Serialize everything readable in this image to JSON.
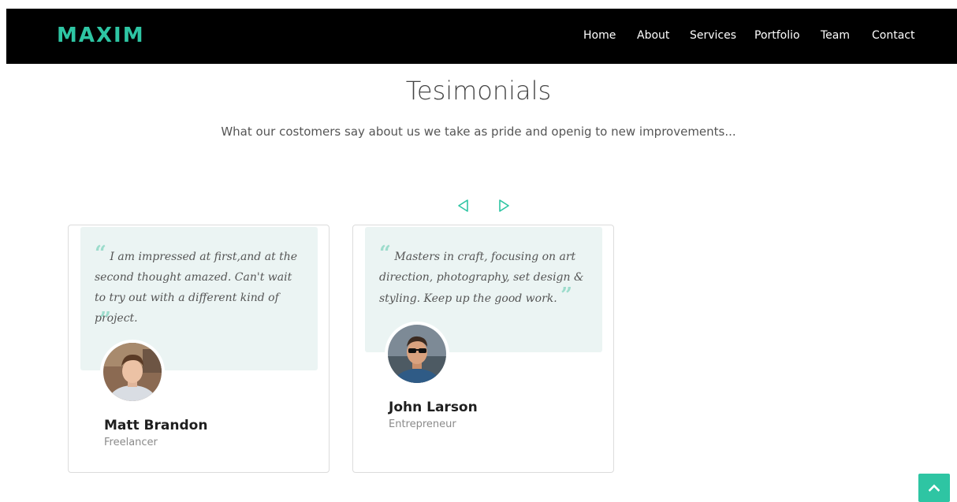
{
  "header": {
    "brand": "MAXIM",
    "nav": [
      "Home",
      "About",
      "Services",
      "Portfolio",
      "Team",
      "Contact"
    ]
  },
  "section": {
    "title": "Tesimonials",
    "subtitle": "What our costomers say about us we take as pride and openig to new improvements..."
  },
  "testimonials": [
    {
      "quote": "I am impressed at first,and at the second thought amazed. Can't wait to try out with a different kind of project.",
      "name": "Matt Brandon",
      "role": "Freelancer"
    },
    {
      "quote": "Masters in craft, focusing on art direction, photography, set design & styling. Keep up the good work.",
      "name": "John Larson",
      "role": "Entrepreneur"
    }
  ],
  "colors": {
    "accent": "#2ec5a3",
    "navbar": "#000000",
    "quote_bg": "#ebf4f3"
  },
  "icons": {
    "prev": "chevron-left-outline-icon",
    "next": "chevron-right-outline-icon",
    "back_to_top": "chevron-up-icon"
  }
}
